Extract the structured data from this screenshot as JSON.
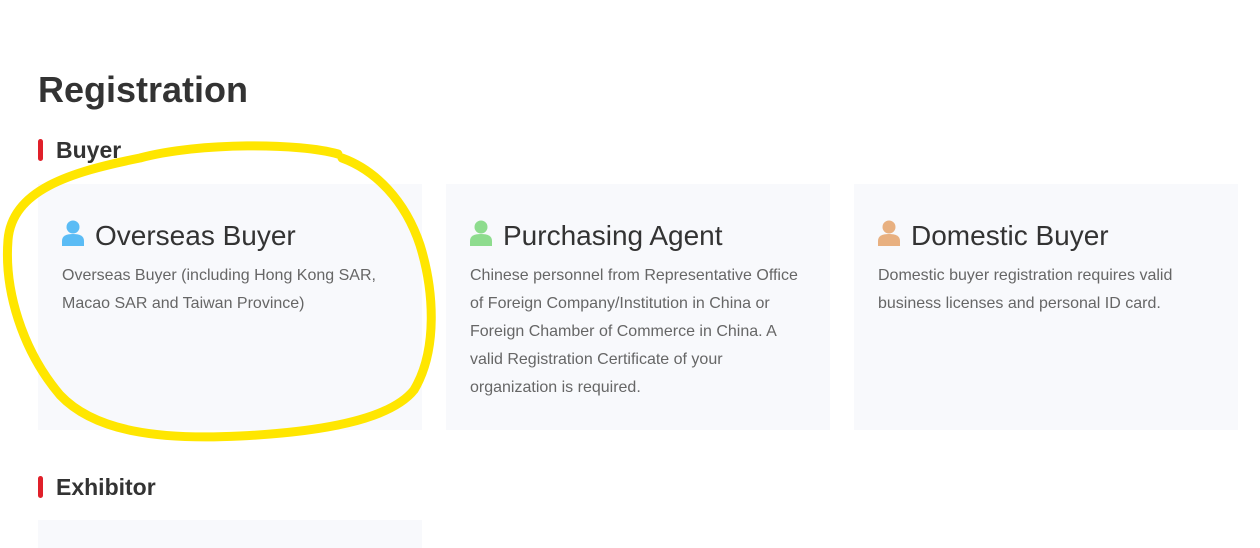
{
  "page": {
    "title": "Registration"
  },
  "sections": {
    "buyer": {
      "label": "Buyer"
    },
    "exhibitor": {
      "label": "Exhibitor"
    }
  },
  "cards": [
    {
      "title": "Overseas Buyer",
      "description": "Overseas Buyer (including Hong Kong SAR, Macao SAR and Taiwan Province)",
      "icon": "person-icon",
      "icon_color": "#5bbcf5"
    },
    {
      "title": "Purchasing Agent",
      "description": "Chinese personnel from Representative Office of Foreign Company/Institution in China or Foreign Chamber of Commerce in China. A valid Registration Certificate of your organization is required.",
      "icon": "person-icon",
      "icon_color": "#8edc8e"
    },
    {
      "title": "Domestic Buyer",
      "description": "Domestic buyer registration requires valid business licenses and personal ID card.",
      "icon": "person-icon",
      "icon_color": "#e8b080"
    }
  ],
  "colors": {
    "accent_bar": "#e0202a",
    "card_background": "#f8f9fc",
    "highlight_annotation": "#ffe600"
  }
}
